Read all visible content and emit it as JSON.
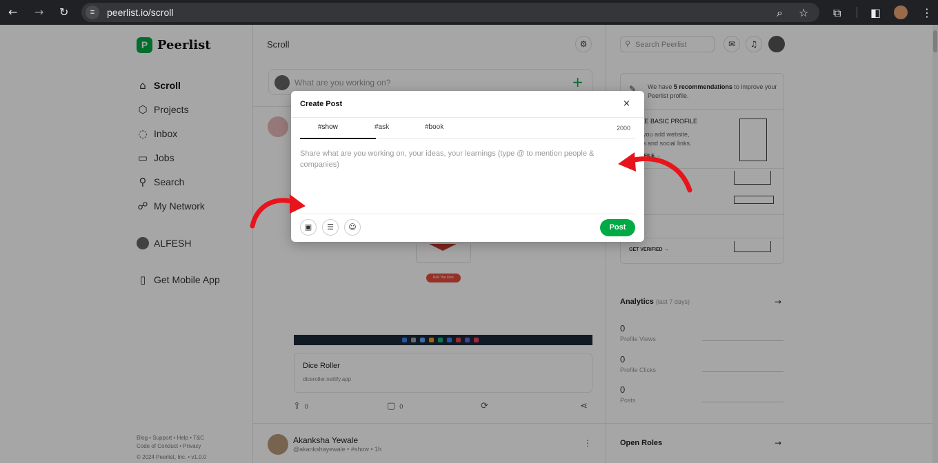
{
  "browser": {
    "url": "peerlist.io/scroll",
    "icons": [
      "back-arrow-icon",
      "forward-arrow-icon",
      "reload-icon",
      "site-info-icon",
      "zoom-icon",
      "bookmark-star-icon",
      "extensions-icon",
      "side-panel-icon",
      "profile-avatar",
      "menu-kebab-icon"
    ]
  },
  "brand": {
    "logo_letter": "P",
    "name": "Peerlist",
    "color": "#00aa45"
  },
  "sidebar": {
    "items": [
      {
        "label": "Scroll",
        "icon": "home-icon"
      },
      {
        "label": "Projects",
        "icon": "cube-icon"
      },
      {
        "label": "Inbox",
        "icon": "chat-icon"
      },
      {
        "label": "Jobs",
        "icon": "briefcase-icon"
      },
      {
        "label": "Search",
        "icon": "search-icon"
      },
      {
        "label": "My Network",
        "icon": "network-icon"
      }
    ],
    "user": "ALFESH",
    "mobile_app": "Get Mobile App",
    "footer": {
      "line1": "Blog • Support • Help • T&C",
      "line2": "Code of Conduct • Privacy",
      "line3": "© 2024 Peerlist, Inc. • v1.0.0"
    }
  },
  "feed": {
    "title": "Scroll",
    "composer_placeholder": "What are you working on?",
    "post1": {
      "badge": "Roll The Dice",
      "link_title": "Dice Roller",
      "link_url": "diceroller.netlify.app",
      "upvotes": "0",
      "comments": "0"
    },
    "post2": {
      "name": "Akanksha Yewale",
      "meta": "@akankshayewale • #show • 1h"
    }
  },
  "right": {
    "search_placeholder": "Search Peerlist",
    "recommendation": {
      "prefix": "We have ",
      "count_text": "5 recommendations",
      "suffix": " to improve your Peerlist profile."
    },
    "basic_profile": {
      "title": "PLETE BASIC PROFILE",
      "desc1": "sure you add website,",
      "desc2": "e tags and social links.",
      "link": "E PROFILE →"
    },
    "links": [
      "T →",
      "→",
      "GET VERIFIED →"
    ],
    "analytics": {
      "title": "Analytics",
      "range": "(last 7 days)",
      "stats": [
        {
          "value": "0",
          "label": "Profile Views"
        },
        {
          "value": "0",
          "label": "Profile Clicks"
        },
        {
          "value": "0",
          "label": "Posts"
        }
      ]
    },
    "open_roles": "Open Roles"
  },
  "modal": {
    "title": "Create Post",
    "close": "×",
    "tabs": [
      "#show",
      "#ask",
      "#book"
    ],
    "active_tab": "#show",
    "char_limit": "2000",
    "placeholder": "Share what are you working on, your ideas, your learnings (type @ to mention people & companies)",
    "tools": [
      "image-upload-icon",
      "list-icon",
      "emoji-icon"
    ],
    "post_button": "Post"
  },
  "annotation": {
    "arrow_color": "#e8141c"
  }
}
